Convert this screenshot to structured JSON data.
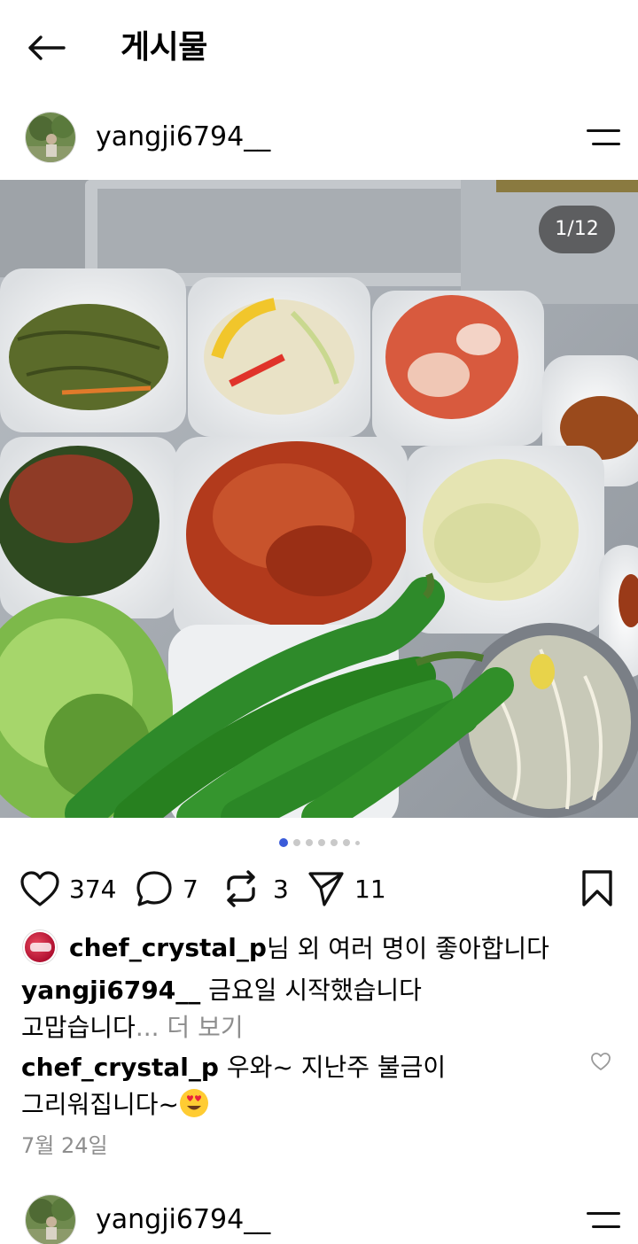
{
  "header": {
    "title": "게시물"
  },
  "post": {
    "username": "yangji6794__",
    "image_counter": "1/12",
    "carousel": {
      "total_dots": 7,
      "active_index": 0
    },
    "actions": {
      "likes": "374",
      "comments": "7",
      "reposts": "3",
      "shares": "11"
    },
    "liked_by": {
      "user": "chef_crystal_p",
      "suffix": "님 외 여러 명이 좋아합니다"
    },
    "caption": {
      "user": "yangji6794__",
      "line1": " 금요일 시작했습니다",
      "line2": "고맙습니다",
      "ellipsis": "...",
      "more": " 더 보기"
    },
    "comment": {
      "user": "chef_crystal_p",
      "line1": " 우와~ 지난주 불금이",
      "line2": "그리워집니다~"
    },
    "date": "7월 24일"
  },
  "next_post": {
    "username": "yangji6794__"
  },
  "colors": {
    "accent": "#3a5bd9",
    "muted": "#8e8e8e"
  }
}
